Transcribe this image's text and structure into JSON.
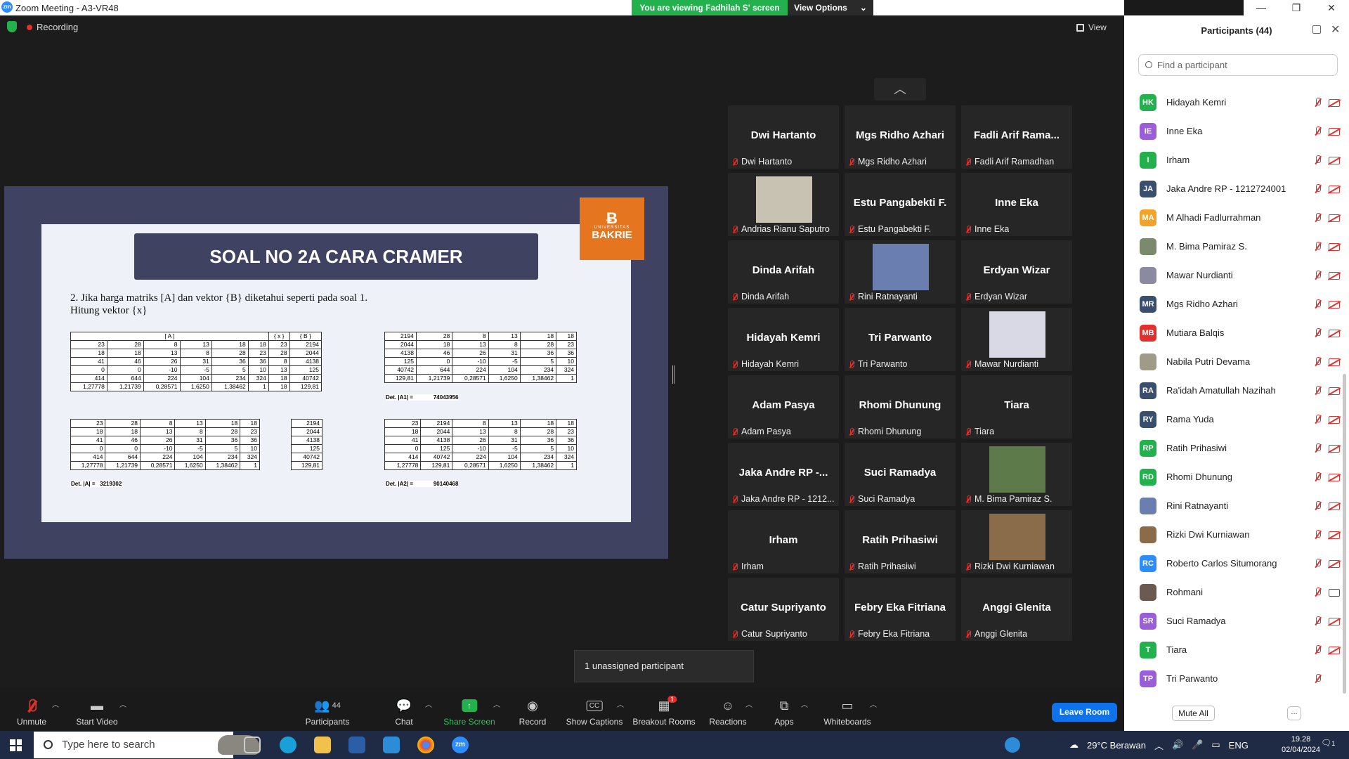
{
  "window": {
    "title": "Zoom Meeting - A3-VR48",
    "app_badge": "zm"
  },
  "banner": {
    "viewing": "You are viewing Fadhilah S' screen",
    "view_options": "View Options"
  },
  "topbar": {
    "recording": "Recording",
    "view": "View"
  },
  "slide": {
    "title": "SOAL NO 2A CARA CRAMER",
    "logo_line1": "UNIVERSITAS",
    "logo_line2": "BAKRIE",
    "question_line1": "2. Jika harga matriks [A] dan vektor {B} diketahui seperti pada soal 1.",
    "question_line2": "Hitung vektor {x}",
    "t1_header": [
      "[ A ]",
      "{ x }",
      "{ B }"
    ],
    "t1_rows": [
      [
        "23",
        "28",
        "8",
        "13",
        "18",
        "18",
        "23",
        "2194"
      ],
      [
        "18",
        "18",
        "13",
        "8",
        "28",
        "23",
        "28",
        "2044"
      ],
      [
        "41",
        "46",
        "26",
        "31",
        "36",
        "36",
        "8",
        "4138"
      ],
      [
        "0",
        "0",
        "-10",
        "-5",
        "5",
        "10",
        "13",
        "125"
      ],
      [
        "414",
        "644",
        "224",
        "104",
        "234",
        "324",
        "18",
        "40742"
      ],
      [
        "1,27778",
        "1,21739",
        "0,28571",
        "1,6250",
        "1,38462",
        "1",
        "18",
        "129,81"
      ]
    ],
    "t2_rows": [
      [
        "2194",
        "28",
        "8",
        "13",
        "18",
        "18"
      ],
      [
        "2044",
        "18",
        "13",
        "8",
        "28",
        "23"
      ],
      [
        "4138",
        "46",
        "26",
        "31",
        "36",
        "36"
      ],
      [
        "125",
        "0",
        "-10",
        "-5",
        "5",
        "10"
      ],
      [
        "40742",
        "644",
        "224",
        "104",
        "234",
        "324"
      ],
      [
        "129,81",
        "1,21739",
        "0,28571",
        "1,6250",
        "1,38462",
        "1"
      ]
    ],
    "t2_det_label": "Det. |A1| =",
    "t2_det_value": "74043956",
    "t3_rows": [
      [
        "23",
        "28",
        "8",
        "13",
        "18",
        "18"
      ],
      [
        "18",
        "18",
        "13",
        "8",
        "28",
        "23"
      ],
      [
        "41",
        "46",
        "26",
        "31",
        "36",
        "36"
      ],
      [
        "0",
        "0",
        "-10",
        "-5",
        "5",
        "10"
      ],
      [
        "414",
        "644",
        "224",
        "104",
        "234",
        "324"
      ],
      [
        "1,27778",
        "1,21739",
        "0,28571",
        "1,6250",
        "1,38462",
        "1"
      ]
    ],
    "t3b_rows": [
      "2194",
      "2044",
      "4138",
      "125",
      "40742",
      "129,81"
    ],
    "t3_det_label": "Det. |A| =",
    "t3_det_value": "3219302",
    "t4_rows": [
      [
        "23",
        "2194",
        "8",
        "13",
        "18",
        "18"
      ],
      [
        "18",
        "2044",
        "13",
        "8",
        "28",
        "23"
      ],
      [
        "41",
        "4138",
        "26",
        "31",
        "36",
        "36"
      ],
      [
        "0",
        "125",
        "-10",
        "-5",
        "5",
        "10"
      ],
      [
        "414",
        "40742",
        "224",
        "104",
        "234",
        "324"
      ],
      [
        "1,27778",
        "129,81",
        "0,28571",
        "1,6250",
        "1,38462",
        "1"
      ]
    ],
    "t4_det_label": "Det. |A2| =",
    "t4_det_value": "90140468"
  },
  "gallery": [
    {
      "big": "Dwi Hartanto",
      "label": "Dwi Hartanto"
    },
    {
      "big": "Mgs Ridho Azhari",
      "label": "Mgs Ridho Azhari"
    },
    {
      "big": "Fadli Arif Rama...",
      "label": "Fadli Arif Ramadhan"
    },
    {
      "big": "",
      "label": "Andrias Rianu Saputro",
      "photo": "#c8c2b2"
    },
    {
      "big": "Estu Pangabekti F.",
      "label": "Estu Pangabekti F."
    },
    {
      "big": "Inne Eka",
      "label": "Inne Eka"
    },
    {
      "big": "Dinda Arifah",
      "label": "Dinda Arifah"
    },
    {
      "big": "",
      "label": "Rini Ratnayanti",
      "photo": "#6a7fb0"
    },
    {
      "big": "Erdyan Wizar",
      "label": "Erdyan Wizar"
    },
    {
      "big": "Hidayah Kemri",
      "label": "Hidayah Kemri"
    },
    {
      "big": "Tri Parwanto",
      "label": "Tri Parwanto"
    },
    {
      "big": "",
      "label": "Mawar Nurdianti",
      "photo": "#d9d9e6"
    },
    {
      "big": "Adam Pasya",
      "label": "Adam Pasya"
    },
    {
      "big": "Rhomi Dhunung",
      "label": "Rhomi Dhunung"
    },
    {
      "big": "Tiara",
      "label": "Tiara"
    },
    {
      "big": "Jaka Andre RP -...",
      "label": "Jaka Andre RP - 1212..."
    },
    {
      "big": "Suci Ramadya",
      "label": "Suci Ramadya"
    },
    {
      "big": "",
      "label": "M. Bima Pamiraz S.",
      "photo": "#5d7a4a"
    },
    {
      "big": "Irham",
      "label": "Irham"
    },
    {
      "big": "Ratih Prihasiwi",
      "label": "Ratih Prihasiwi"
    },
    {
      "big": "",
      "label": "Rizki Dwi Kurniawan",
      "photo": "#8a6b4a"
    },
    {
      "big": "Catur Supriyanto",
      "label": "Catur Supriyanto"
    },
    {
      "big": "Febry Eka Fitriana",
      "label": "Febry Eka Fitriana"
    },
    {
      "big": "Anggi Glenita",
      "label": "Anggi Glenita"
    }
  ],
  "unassigned": "1 unassigned participant",
  "toolbar": {
    "unmute": "Unmute",
    "start_video": "Start Video",
    "participants": "Participants",
    "participants_count": "44",
    "chat": "Chat",
    "share_screen": "Share Screen",
    "record": "Record",
    "captions": "Show Captions",
    "captions_icon": "CC",
    "breakout": "Breakout Rooms",
    "breakout_badge": "1",
    "reactions": "Reactions",
    "apps": "Apps",
    "whiteboards": "Whiteboards",
    "leave": "Leave Room"
  },
  "panel": {
    "title": "Participants (44)",
    "search_placeholder": "Find a participant",
    "mute_all": "Mute All",
    "more": "...",
    "participants": [
      {
        "initials": "HK",
        "name": "Hidayah Kemri",
        "color": "#23b14d",
        "cam": "off"
      },
      {
        "initials": "IE",
        "name": "Inne Eka",
        "color": "#9a5fd6",
        "cam": "off"
      },
      {
        "initials": "I",
        "name": "Irham",
        "color": "#23b14d",
        "cam": "off"
      },
      {
        "initials": "JA",
        "name": "Jaka Andre RP - 1212724001",
        "color": "#3a4e6e",
        "cam": "off"
      },
      {
        "initials": "MA",
        "name": "M Alhadi Fadlurrahman",
        "color": "#f2a32b",
        "cam": "off"
      },
      {
        "initials": "",
        "name": "M. Bima Pamiraz S.",
        "color": "#7a8a6a",
        "cam": "off"
      },
      {
        "initials": "",
        "name": "Mawar Nurdianti",
        "color": "#8a8aa0",
        "cam": "off"
      },
      {
        "initials": "MR",
        "name": "Mgs Ridho Azhari",
        "color": "#3a4e6e",
        "cam": "off"
      },
      {
        "initials": "MB",
        "name": "Mutiara Balqis",
        "color": "#e0312e",
        "cam": "off"
      },
      {
        "initials": "",
        "name": "Nabila Putri Devama",
        "color": "#a09a88",
        "cam": "off"
      },
      {
        "initials": "RA",
        "name": "Ra'idah Amatullah Nazihah",
        "color": "#3a4e6e",
        "cam": "off"
      },
      {
        "initials": "RY",
        "name": "Rama Yuda",
        "color": "#3a4e6e",
        "cam": "off"
      },
      {
        "initials": "RP",
        "name": "Ratih Prihasiwi",
        "color": "#23b14d",
        "cam": "off"
      },
      {
        "initials": "RD",
        "name": "Rhomi Dhunung",
        "color": "#23b14d",
        "cam": "off"
      },
      {
        "initials": "",
        "name": "Rini Ratnayanti",
        "color": "#6a7fb0",
        "cam": "off"
      },
      {
        "initials": "",
        "name": "Rizki Dwi Kurniawan",
        "color": "#8a6b4a",
        "cam": "off"
      },
      {
        "initials": "RC",
        "name": "Roberto Carlos Situmorang",
        "color": "#2d8cff",
        "cam": "off"
      },
      {
        "initials": "",
        "name": "Rohmani",
        "color": "#6a5a50",
        "cam": "on"
      },
      {
        "initials": "SR",
        "name": "Suci Ramadya",
        "color": "#9a5fd6",
        "cam": "off"
      },
      {
        "initials": "T",
        "name": "Tiara",
        "color": "#23b14d",
        "cam": "off"
      },
      {
        "initials": "TP",
        "name": "Tri Parwanto",
        "color": "#9a5fd6",
        "cam": "none"
      }
    ]
  },
  "taskbar": {
    "search_placeholder": "Type here to search",
    "weather": "29°C Berawan",
    "lang": "ENG",
    "time": "19.28",
    "date": "02/04/2024",
    "notif_count": "1"
  }
}
